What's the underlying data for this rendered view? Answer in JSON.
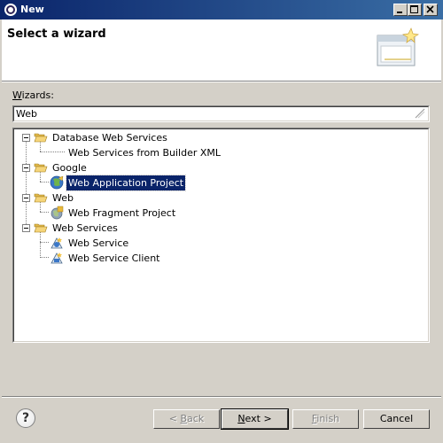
{
  "window": {
    "title": "New"
  },
  "header": {
    "title": "Select a wizard"
  },
  "wizards": {
    "label_mnemonic": "W",
    "label_rest": "izards:",
    "filter_value": "Web"
  },
  "tree": {
    "items": [
      {
        "label": "Database Web Services"
      },
      {
        "label": "Web Services from Builder XML"
      },
      {
        "label": "Google"
      },
      {
        "label": "Web Application Project"
      },
      {
        "label": "Web"
      },
      {
        "label": "Web Fragment Project"
      },
      {
        "label": "Web Services"
      },
      {
        "label": "Web Service"
      },
      {
        "label": "Web Service Client"
      }
    ]
  },
  "buttons": {
    "help": "?",
    "back_prefix": "< ",
    "back_mnemonic": "B",
    "back_rest": "ack",
    "next_mnemonic": "N",
    "next_rest": "ext >",
    "finish_mnemonic": "F",
    "finish_rest": "inish",
    "cancel": "Cancel"
  },
  "colors": {
    "titlebar": "#0a246a",
    "selection": "#0a246a",
    "folder": "#f5d57a"
  }
}
